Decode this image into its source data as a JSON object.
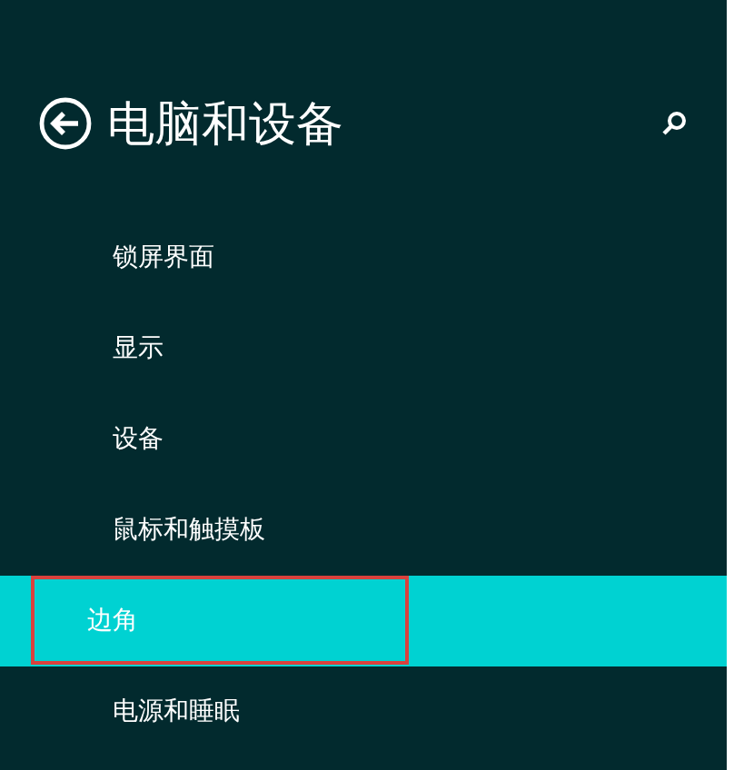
{
  "header": {
    "title": "电脑和设备"
  },
  "items": [
    {
      "label": "锁屏界面",
      "selected": false,
      "highlighted": false
    },
    {
      "label": "显示",
      "selected": false,
      "highlighted": false
    },
    {
      "label": "设备",
      "selected": false,
      "highlighted": false
    },
    {
      "label": "鼠标和触摸板",
      "selected": false,
      "highlighted": false
    },
    {
      "label": "边角",
      "selected": true,
      "highlighted": true
    },
    {
      "label": "电源和睡眠",
      "selected": false,
      "highlighted": false
    }
  ]
}
